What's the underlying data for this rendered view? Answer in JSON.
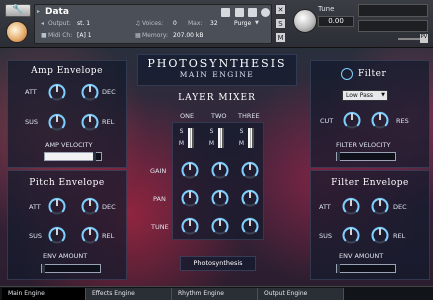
{
  "header": {
    "instrument_name": "Data",
    "output_label": "Output:",
    "output_value": "st. 1",
    "midi_label": "Midi Ch:",
    "midi_value": "[A] 1",
    "voices_label": "Voices:",
    "voices_value": "0",
    "max_label": "Max:",
    "max_value": "32",
    "purge_label": "Purge",
    "memory_label": "Memory:",
    "memory_value": "207.00 kB",
    "tune_label": "Tune",
    "tune_value": "0.00",
    "side_buttons": [
      "S",
      "M"
    ]
  },
  "title": {
    "main": "PHOTOSYNTHESIS",
    "sub": "MAIN ENGINE"
  },
  "amp_envelope": {
    "title": "Amp Envelope",
    "knobs": [
      "ATT",
      "DEC",
      "SUS",
      "REL"
    ],
    "velocity_label": "AMP VELOCITY",
    "velocity_level": 0.85
  },
  "pitch_envelope": {
    "title": "Pitch Envelope",
    "knobs": [
      "ATT",
      "DEC",
      "SUS",
      "REL"
    ],
    "amount_label": "ENV AMOUNT",
    "amount_level": 0.0
  },
  "layer_mixer": {
    "title": "LAYER MIXER",
    "columns": [
      "ONE",
      "TWO",
      "THREE"
    ],
    "rows": [
      "GAIN",
      "PAN",
      "TUNE"
    ],
    "s_label": "S",
    "m_label": "M",
    "preset_label": "Photosynthesis"
  },
  "filter": {
    "title": "Filter",
    "type_value": "Low Pass",
    "knobs": [
      "CUT",
      "RES"
    ],
    "velocity_label": "FILTER VELOCITY",
    "velocity_level": 0.0
  },
  "filter_envelope": {
    "title": "Filter Envelope",
    "knobs": [
      "ATT",
      "DEC",
      "SUS",
      "REL"
    ],
    "amount_label": "ENV AMOUNT",
    "amount_level": 0.0
  },
  "tabs": [
    "Main Engine",
    "Effects Engine",
    "Rhythm Engine",
    "Output Engine"
  ],
  "active_tab": "Main Engine",
  "colors": {
    "accent_knob": "#7fd0ff",
    "panel_bg": "#121a2c",
    "header_bg": "#3a3d44"
  }
}
